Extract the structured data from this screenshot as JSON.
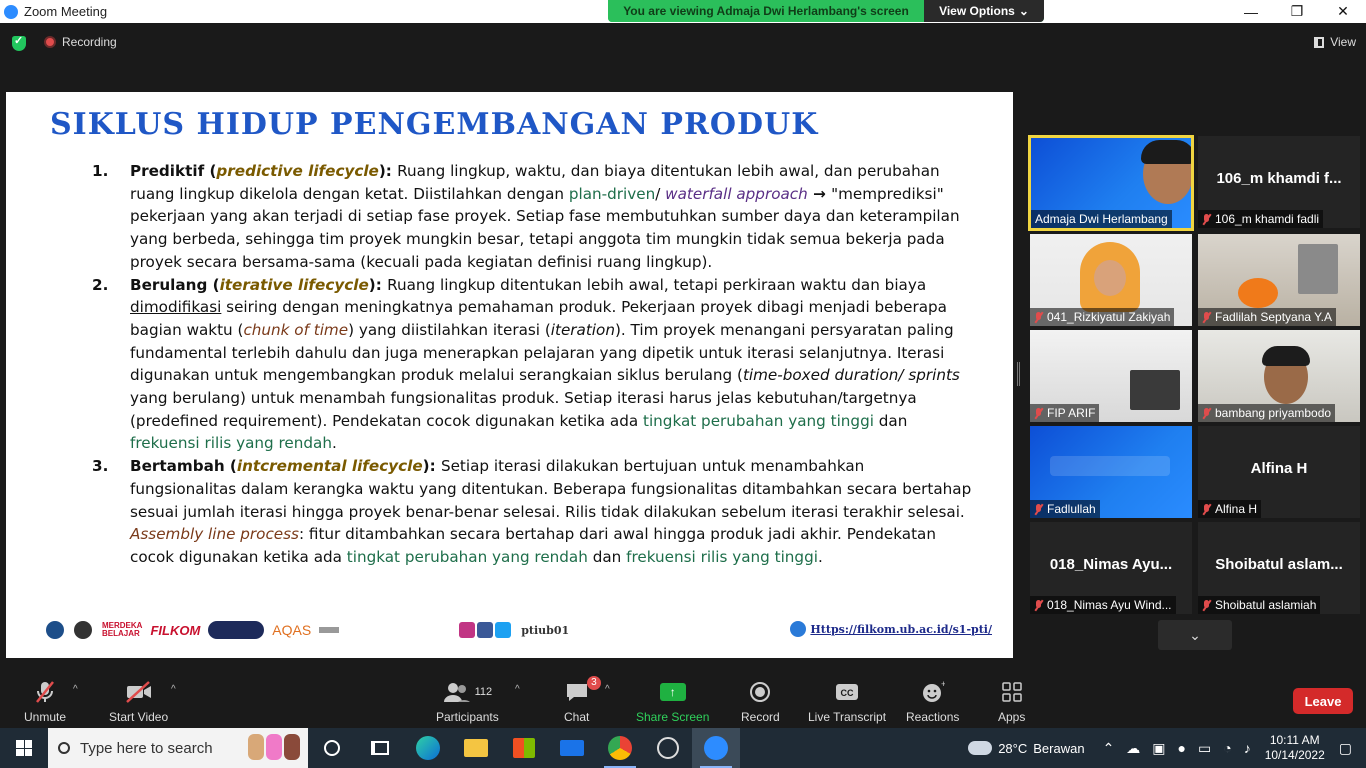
{
  "window": {
    "app_title": "Zoom Meeting",
    "minimize": "—",
    "maximize": "❐",
    "close": "✕"
  },
  "share_banner": {
    "text": "You are viewing Admaja Dwi Herlambang's screen",
    "options_label": "View Options",
    "options_caret": "⌄"
  },
  "meeting": {
    "recording_label": "Recording",
    "view_label": "View"
  },
  "slide": {
    "title": "SIKLUS HIDUP PENGEMBANGAN PRODUK",
    "items": [
      {
        "num": "1.",
        "name": "Prediktif",
        "term": "predictive lifecycle",
        "p1": "Ruang lingkup, waktu, dan biaya ditentukan lebih awal, dan perubahan ruang lingkup dikelola dengan ketat. Diistilahkan dengan ",
        "green1": "plan-driven",
        "sep": "/ ",
        "purple1": "waterfall approach",
        "arrow": " → ",
        "p2": "\"memprediksi\" pekerjaan yang akan terjadi di setiap fase proyek. Setiap fase membutuhkan sumber daya dan keterampilan yang berbeda, sehingga tim proyek mungkin besar, tetapi anggota tim mungkin tidak semua bekerja pada proyek secara bersama-sama (kecuali pada kegiatan definisi ruang lingkup)."
      },
      {
        "num": "2.",
        "name": "Berulang",
        "term": "iterative lifecycle",
        "p1": "Ruang lingkup ditentukan lebih awal, tetapi perkiraan waktu dan biaya ",
        "underline": "dimodifikasi",
        "p2": " seiring dengan meningkatnya pemahaman produk. Pekerjaan proyek dibagi menjadi beberapa bagian waktu (",
        "brown1": "chunk of time",
        "p3": ") yang diistilahkan iterasi (",
        "italic1": "iteration",
        "p4": "). Tim proyek menangani persyaratan paling fundamental terlebih dahulu dan juga menerapkan pelajaran yang dipetik untuk iterasi selanjutnya.  Iterasi digunakan untuk mengembangkan produk melalui serangkaian siklus berulang (",
        "italic2": "time-boxed duration/ sprints",
        "p5": " yang berulang) untuk menambah fungsionalitas produk. Setiap iterasi harus jelas kebutuhan/targetnya (predefined requirement). Pendekatan cocok digunakan ketika ada ",
        "green1": "tingkat perubahan yang tinggi",
        "p6": " dan ",
        "green2": "frekuensi rilis yang rendah",
        "p7": "."
      },
      {
        "num": "3.",
        "name": "Bertambah",
        "term": "intcremental lifecycle",
        "p1": "Setiap iterasi dilakukan bertujuan untuk menambahkan fungsionalitas dalam kerangka waktu yang ditentukan. Beberapa fungsionalitas ditambahkan secara bertahap sesuai jumlah iterasi hingga proyek benar-benar selesai. Rilis tidak dilakukan sebelum iterasi terakhir selesai. ",
        "brown1": "Assembly line process",
        "p2": ": fitur ditambahkan secara bertahap dari awal hingga produk jadi akhir. Pendekatan cocok digunakan ketika ada ",
        "green1": "tingkat perubahan yang rendah",
        "p3": " dan ",
        "green2": "frekuensi rilis yang tinggi",
        "p4": "."
      }
    ],
    "footer": {
      "merdeka_1": "MERDEKA",
      "merdeka_2": "BELAJAR",
      "filkom": "FILKOM",
      "aqas": "AQAS",
      "social_handle": "ptiub01",
      "url": "Https://filkom.ub.ac.id/s1-pti/"
    }
  },
  "participants": [
    {
      "name": "Admaja Dwi Herlambang",
      "video": true,
      "active": true,
      "muted": false
    },
    {
      "name": "106_m khamdi fadli",
      "big_name": "106_m khamdi f...",
      "video": false,
      "muted": true
    },
    {
      "name": "041_Rizkiyatul Zakiyah",
      "video": true,
      "muted": true
    },
    {
      "name": "Fadlilah Septyana Y.A",
      "video": true,
      "muted": true
    },
    {
      "name": "FIP ARIF",
      "video": true,
      "muted": true
    },
    {
      "name": "bambang priyambodo",
      "video": true,
      "muted": true
    },
    {
      "name": "Fadlullah",
      "video": true,
      "muted": true
    },
    {
      "name": "Alfina H",
      "big_name": "Alfina H",
      "video": false,
      "muted": true
    },
    {
      "name": "018_Nimas Ayu Wind...",
      "big_name": "018_Nimas Ayu...",
      "video": false,
      "muted": true
    },
    {
      "name": "Shoibatul aslamiah",
      "big_name": "Shoibatul  aslam...",
      "video": false,
      "muted": true
    }
  ],
  "gallery_expand": "⌄",
  "toolbar": {
    "unmute": "Unmute",
    "start_video": "Start Video",
    "participants": "Participants",
    "participants_count": "112",
    "chat": "Chat",
    "chat_badge": "3",
    "share_screen": "Share Screen",
    "record": "Record",
    "live_transcript": "Live Transcript",
    "reactions": "Reactions",
    "apps": "Apps",
    "leave": "Leave",
    "caret": "^"
  },
  "taskbar": {
    "search_placeholder": "Type here to search",
    "weather_temp": "28°C",
    "weather_desc": "Berawan",
    "time": "10:11 AM",
    "date": "10/14/2022"
  },
  "colors": {
    "zoom_blue": "#2d8cff",
    "banner_green": "#2bbf5b",
    "leave_red": "#d42a2a",
    "slide_title_blue": "#1f57c6",
    "active_speaker_yellow": "#f0d541"
  }
}
